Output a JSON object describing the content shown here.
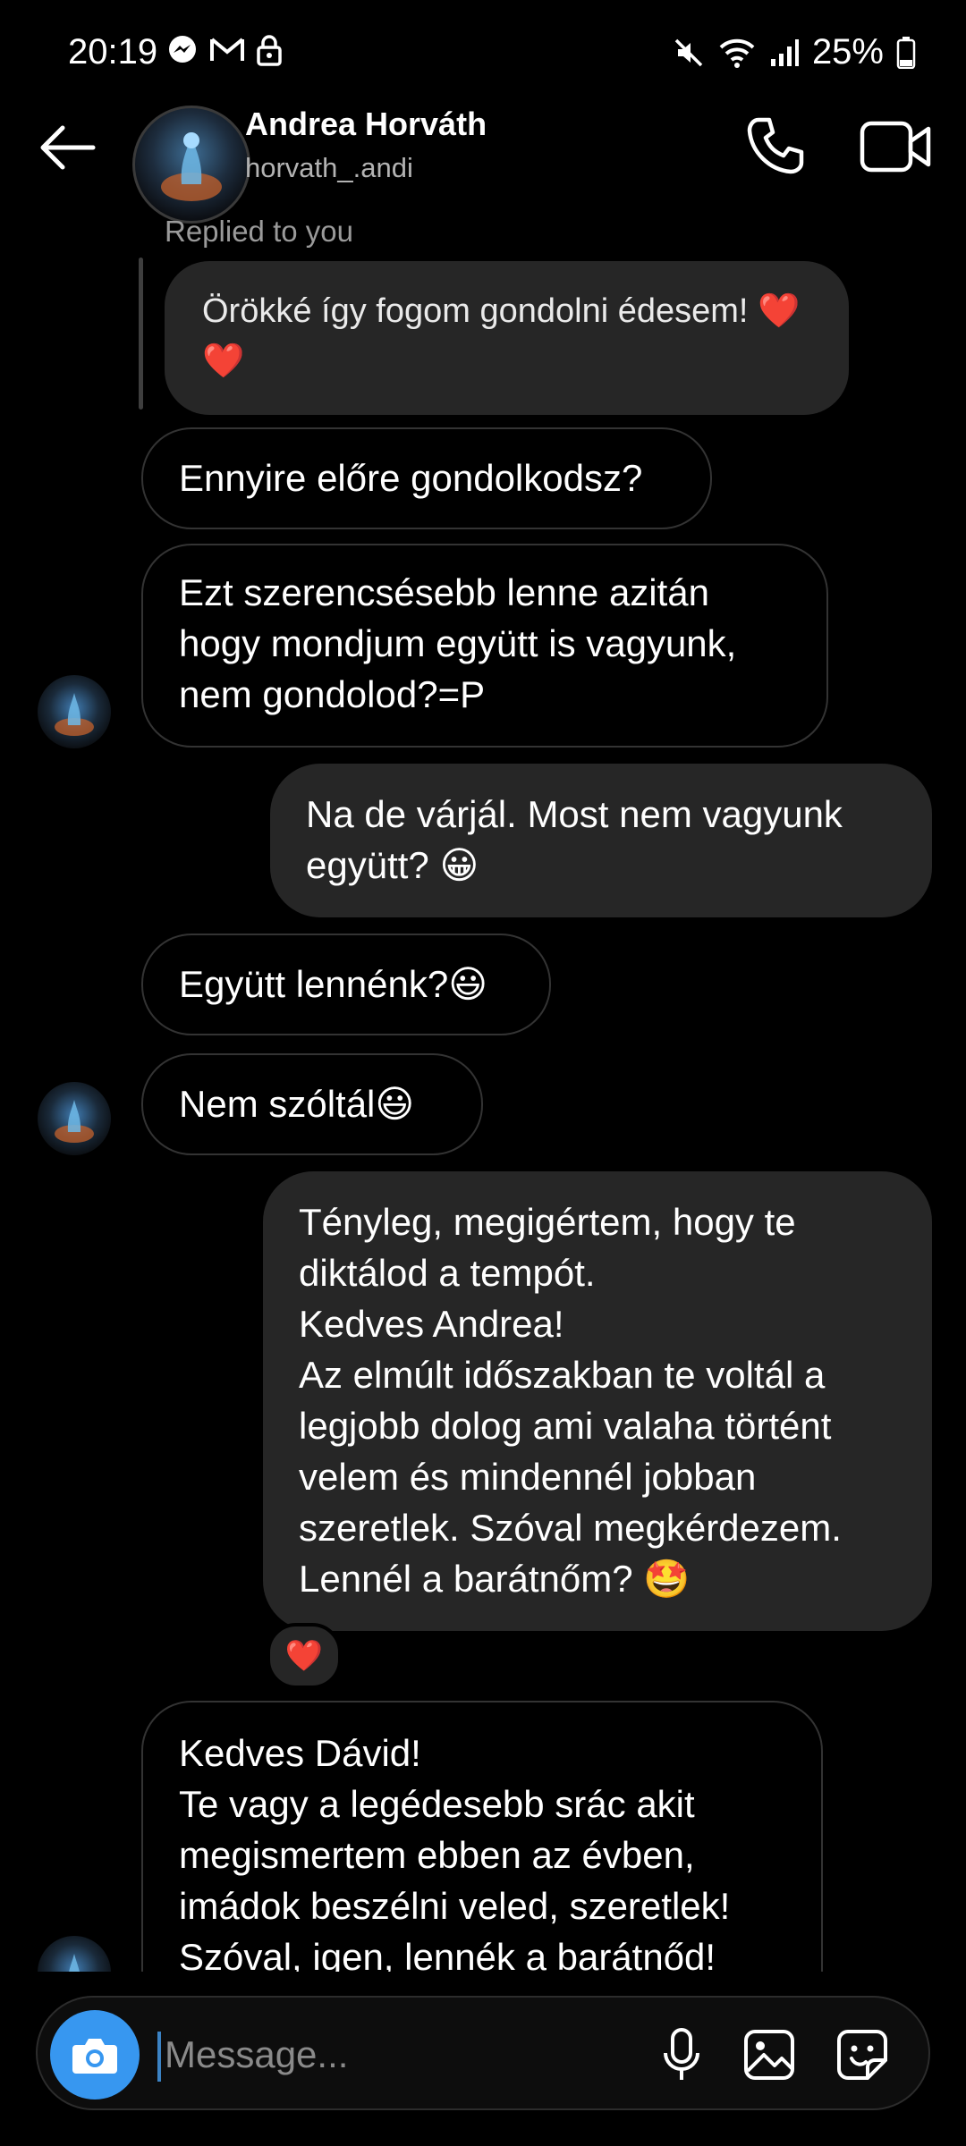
{
  "status_bar": {
    "time": "20:19",
    "battery": "25%"
  },
  "header": {
    "name": "Andrea Horváth",
    "handle": "horvath_.andi"
  },
  "thread": {
    "reply_label": "Replied to you",
    "quoted_text": "Örökké így fogom gondolni édesem! ❤️❤️",
    "messages": [
      {
        "text": "Ennyire előre gondolkodsz?"
      },
      {
        "text": "Ezt szerencsésebb lenne azitán\nhogy mondjum együtt is vagyunk,\nnem gondolod?=P"
      },
      {
        "text": "Na de várjál. Most nem vagyunk\negyütt? 😀"
      },
      {
        "text": "Együtt lennénk?😃"
      },
      {
        "text": "Nem szóltál😃"
      },
      {
        "text": "Tényleg, megigértem, hogy te\ndiktálod a tempót.\nKedves Andrea!\nAz elmúlt időszakban te voltál a\nlegjobb dolog ami valaha történt\nvelem és mindennél jobban\nszeretlek. Szóval megkérdezem.\nLennél a barátnőm? 🤩"
      },
      {
        "text": "Kedves Dávid!\nTe vagy a legédesebb srác akit\nmegismertem ebben az évben,\nimádok beszélni veled, szeretlek!\nSzóval, igen, lennék a barátnőd!"
      }
    ],
    "reaction": "❤️"
  },
  "composer": {
    "placeholder": "Message..."
  }
}
